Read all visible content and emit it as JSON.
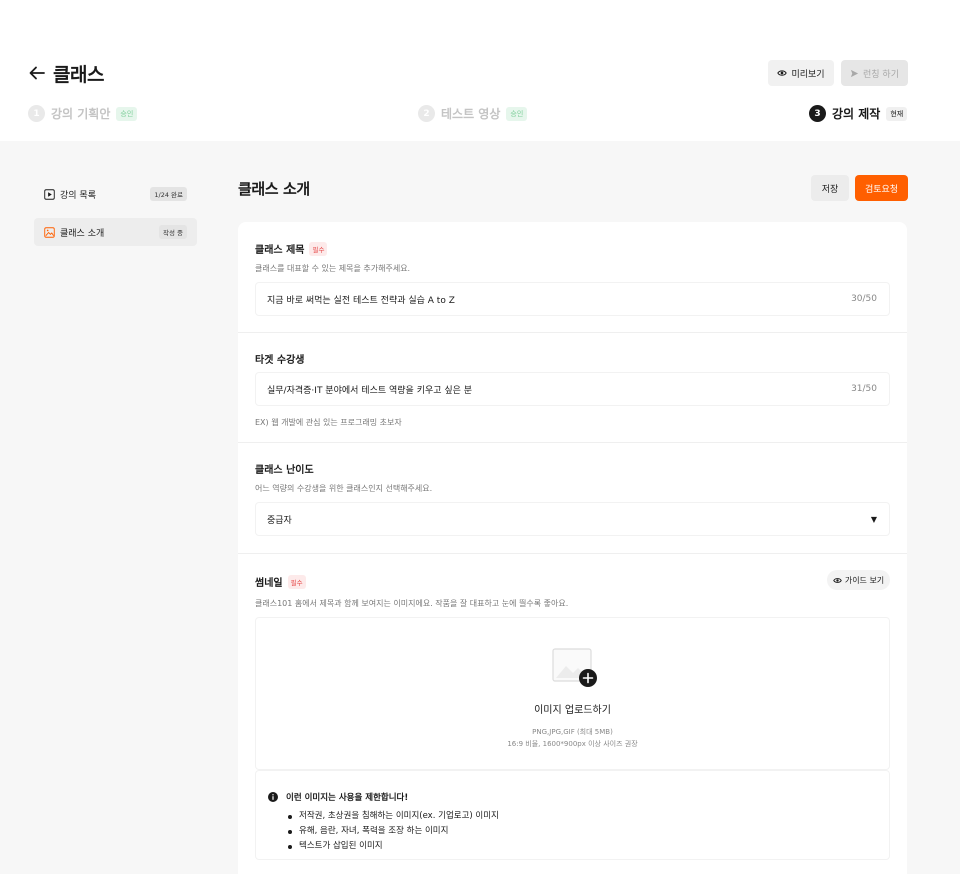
{
  "header": {
    "title": "클래스",
    "preview_label": "미리보기",
    "launch_label": "런칭 하기"
  },
  "steps": [
    {
      "num": "1",
      "label": "강의 기획안",
      "badge": "승인"
    },
    {
      "num": "2",
      "label": "테스트 영상",
      "badge": "승인"
    },
    {
      "num": "3",
      "label": "강의 제작",
      "badge": "현재"
    }
  ],
  "sidebar": {
    "items": [
      {
        "label": "강의 목록",
        "pill": "1/24 완료"
      },
      {
        "label": "클래스 소개",
        "pill": "작성 중"
      }
    ]
  },
  "content": {
    "title": "클래스 소개",
    "save_label": "저장",
    "review_label": "검토요청"
  },
  "form": {
    "class_title": {
      "label": "클래스 제목",
      "required": "필수",
      "desc": "클래스를 대표할 수 있는 제목을 추가해주세요.",
      "value": "지금 바로 써먹는 실전 테스트 전략과 실습 A to Z",
      "count": "30/50"
    },
    "target": {
      "label": "타겟 수강생",
      "value": "실무/자격증·IT 분야에서 테스트 역량을 키우고 싶은 분",
      "count": "31/50",
      "hint": "EX) 웹 개발에 관심 있는 프로그래밍 초보자"
    },
    "difficulty": {
      "label": "클래스 난이도",
      "desc": "어느 역량의 수강생을 위한 클래스인지 선택해주세요.",
      "selected": "중급자"
    },
    "thumbnail": {
      "label": "썸네일",
      "required": "필수",
      "guide_label": "가이드 보기",
      "desc": "클래스101 홈에서 제목과 함께 보여지는 이미지에요. 작품을 잘 대표하고 눈에 띌수록 좋아요.",
      "upload_title": "이미지 업로드하기",
      "upload_format": "PNG,JPG,GIF (최대 5MB)",
      "upload_size": "16:9 비율, 1600*900px 이상 사이즈 권장"
    },
    "warning": {
      "title": "이런 이미지는 사용을 제한합니다!",
      "items": [
        "저작권, 초상권을 침해하는 이미지(ex. 기업로고) 이미지",
        "유해, 음란, 자녀, 폭력을 조장 하는 이미지",
        "텍스트가 삽입된 이미지"
      ]
    }
  },
  "colors": {
    "accent": "#ff5f00",
    "approved_badge": "#e6f6ec",
    "required_badge": "#fdeaea"
  }
}
